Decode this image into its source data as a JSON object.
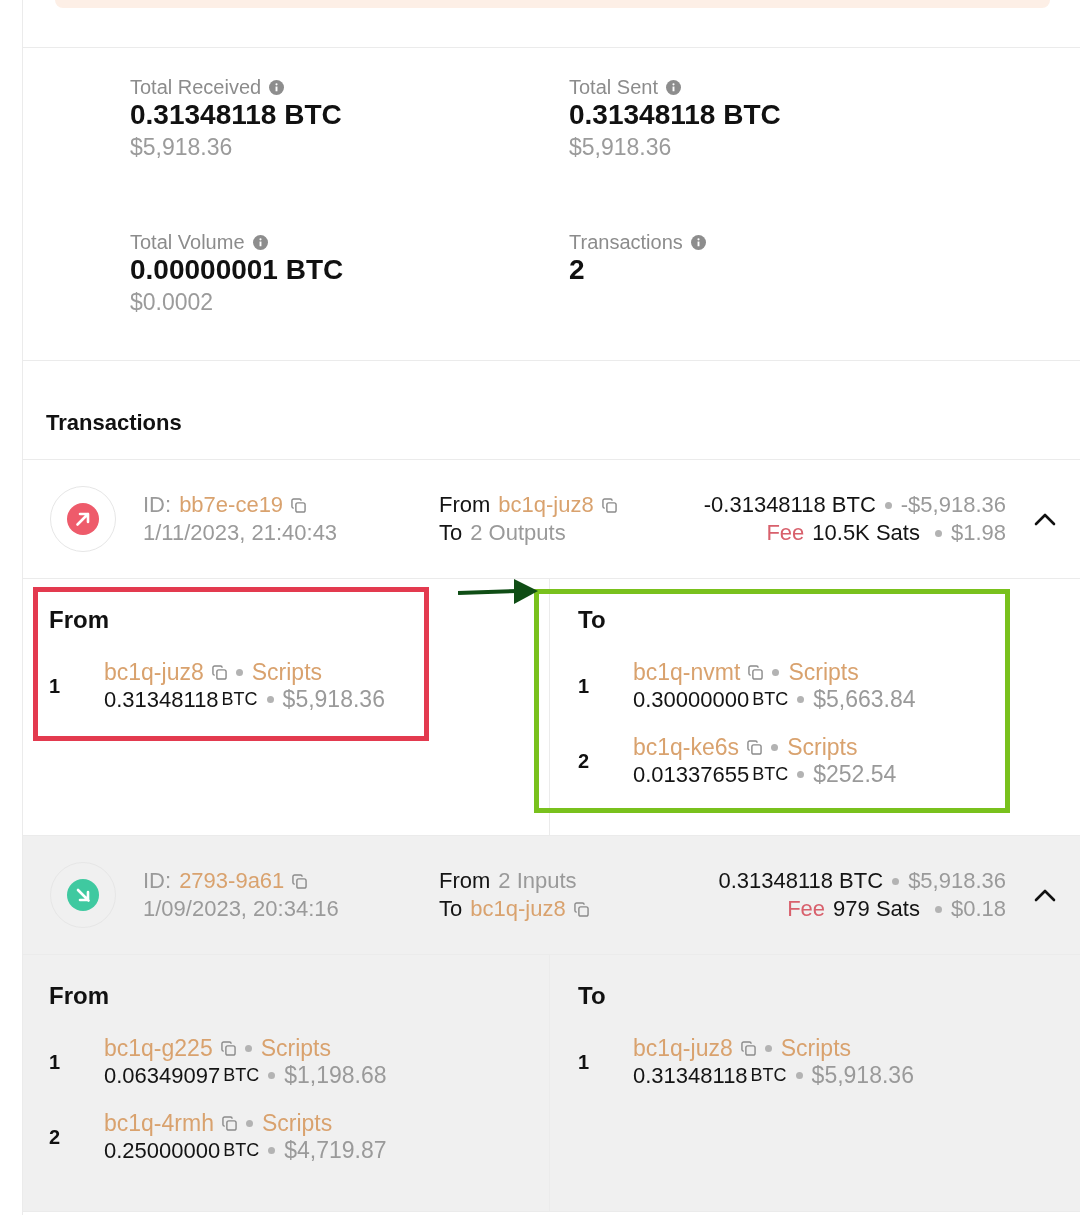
{
  "summary": [
    {
      "label": "Total Received",
      "value": "0.31348118 BTC",
      "fiat": "$5,918.36"
    },
    {
      "label": "Total Sent",
      "value": "0.31348118 BTC",
      "fiat": "$5,918.36"
    },
    {
      "label": "Total Volume",
      "value": "0.00000001 BTC",
      "fiat": "$0.0002"
    },
    {
      "label": "Transactions",
      "value": "2"
    }
  ],
  "transactions_heading": "Transactions",
  "transactions": [
    {
      "kind": "outgoing",
      "highlighted": false,
      "expanded": true,
      "id_label": "ID:",
      "id": "bb7e-ce19",
      "time": "1/11/2023, 21:40:43",
      "from": {
        "label": "From",
        "kind": "address",
        "text": "bc1q-juz8"
      },
      "to": {
        "label": "To",
        "kind": "count",
        "text": "2 Outputs"
      },
      "amount": "-0.31348118 BTC",
      "fiat": "-$5,918.36",
      "fee_label": "Fee",
      "fee": "10.5K Sats",
      "fee_fiat": "$1.98",
      "annotation": {
        "kind": "arrow"
      },
      "inputs": {
        "title": "From",
        "annotation": {
          "kind": "box",
          "color": "#e33a4f"
        },
        "items": [
          {
            "number": "1",
            "address": "bc1q-juz8",
            "link": "Scripts",
            "amount": "0.31348118",
            "unit": "BTC",
            "fiat": "$5,918.36"
          }
        ]
      },
      "outputs": {
        "title": "To",
        "annotation": {
          "kind": "box",
          "color": "#79c11d"
        },
        "items": [
          {
            "number": "1",
            "address": "bc1q-nvmt",
            "link": "Scripts",
            "amount": "0.30000000",
            "unit": "BTC",
            "fiat": "$5,663.84"
          },
          {
            "number": "2",
            "address": "bc1q-ke6s",
            "link": "Scripts",
            "amount": "0.01337655",
            "unit": "BTC",
            "fiat": "$252.54"
          }
        ]
      }
    },
    {
      "kind": "incoming",
      "highlighted": true,
      "expanded": true,
      "id_label": "ID:",
      "id": "2793-9a61",
      "time": "1/09/2023, 20:34:16",
      "from": {
        "label": "From",
        "kind": "count",
        "text": "2 Inputs"
      },
      "to": {
        "label": "To",
        "kind": "address",
        "text": "bc1q-juz8"
      },
      "amount": "0.31348118 BTC",
      "fiat": "$5,918.36",
      "fee_label": "Fee",
      "fee": "979 Sats",
      "fee_fiat": "$0.18",
      "inputs": {
        "title": "From",
        "items": [
          {
            "number": "1",
            "address": "bc1q-g225",
            "link": "Scripts",
            "amount": "0.06349097",
            "unit": "BTC",
            "fiat": "$1,198.68"
          },
          {
            "number": "2",
            "address": "bc1q-4rmh",
            "link": "Scripts",
            "amount": "0.25000000",
            "unit": "BTC",
            "fiat": "$4,719.87"
          }
        ]
      },
      "outputs": {
        "title": "To",
        "items": [
          {
            "number": "1",
            "address": "bc1q-juz8",
            "link": "Scripts",
            "amount": "0.31348118",
            "unit": "BTC",
            "fiat": "$5,918.36"
          }
        ]
      }
    }
  ]
}
